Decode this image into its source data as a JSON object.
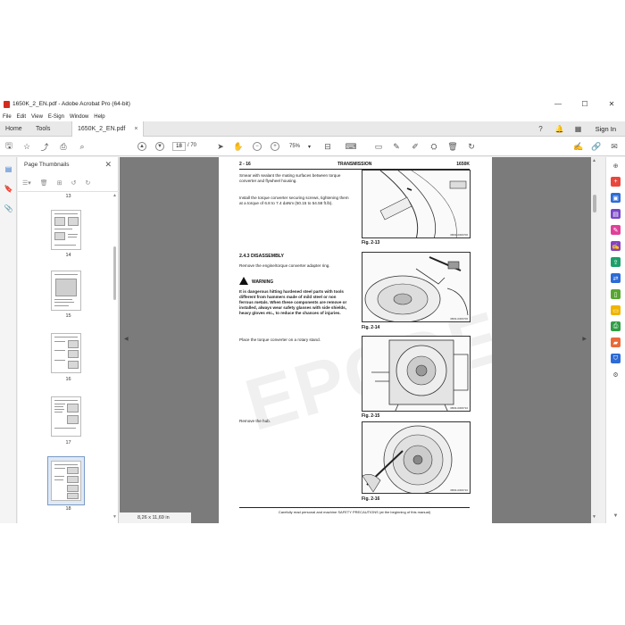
{
  "window": {
    "title": "1650K_2_EN.pdf - Adobe Acrobat Pro (64-bit)",
    "controls": {
      "minimize": "—",
      "maximize": "☐",
      "close": "✕"
    }
  },
  "menu": [
    "File",
    "Edit",
    "View",
    "E-Sign",
    "Window",
    "Help"
  ],
  "tabs": {
    "home": "Home",
    "tools": "Tools",
    "document": "1650K_2_EN.pdf",
    "close": "×",
    "sign_in": "Sign In"
  },
  "toolbar": {
    "current_page": "18",
    "total_pages": "/ 70",
    "zoom": "75%"
  },
  "thumbnails": {
    "title": "Page Thumbnails",
    "close": "✕",
    "pages": [
      "13",
      "14",
      "15",
      "16",
      "17",
      "18"
    ],
    "selected_page": "18"
  },
  "page_size": "8,26 x 11,69 in",
  "document": {
    "header_left": "2 - 16",
    "header_center": "TRANSMISSION",
    "header_right": "1650K",
    "para1": "Smear with sealant the mating surfaces between torque converter and flywheel housing.",
    "para2": "Install the torque converter securing screws, tightening them at a torque of 6.8 to 7.4 daNm (50.15 to 54.58 ft.lb).",
    "section": "2.4.3   DISASSEMBLY",
    "para3": "Remove the engine/torque converter adapter ring.",
    "warning_label": "WARNING",
    "warning_text": "It is dangerous hitting hardened steel parts with tools different from hammers made of mild steel or non ferrous metals. When these components are remove or installed, always wear safety glasses with side shields, heavy gloves etc., to reduce the chances of injuries.",
    "para4": "Place the torque converter on a rotary stand.",
    "para5": "Remove the hub.",
    "figures": [
      {
        "caption": "Fig. 2-13",
        "code": "0B03-0306706"
      },
      {
        "caption": "Fig. 2-14",
        "code": "0B03-0306706"
      },
      {
        "caption": "Fig. 2-15",
        "code": "0B03-0306710"
      },
      {
        "caption": "Fig. 2-16",
        "code": "0B03-0306710"
      }
    ],
    "footer": "Carefully read personal and machine SAFETY PRECAUTIONS (at the beginning of this manual)",
    "watermark": "EPCDEPOT.COM"
  },
  "colors": {
    "acrobat_red": "#d42b1e",
    "doc_background": "#7b7b7b",
    "selected_thumb": "#dfe8f5"
  }
}
